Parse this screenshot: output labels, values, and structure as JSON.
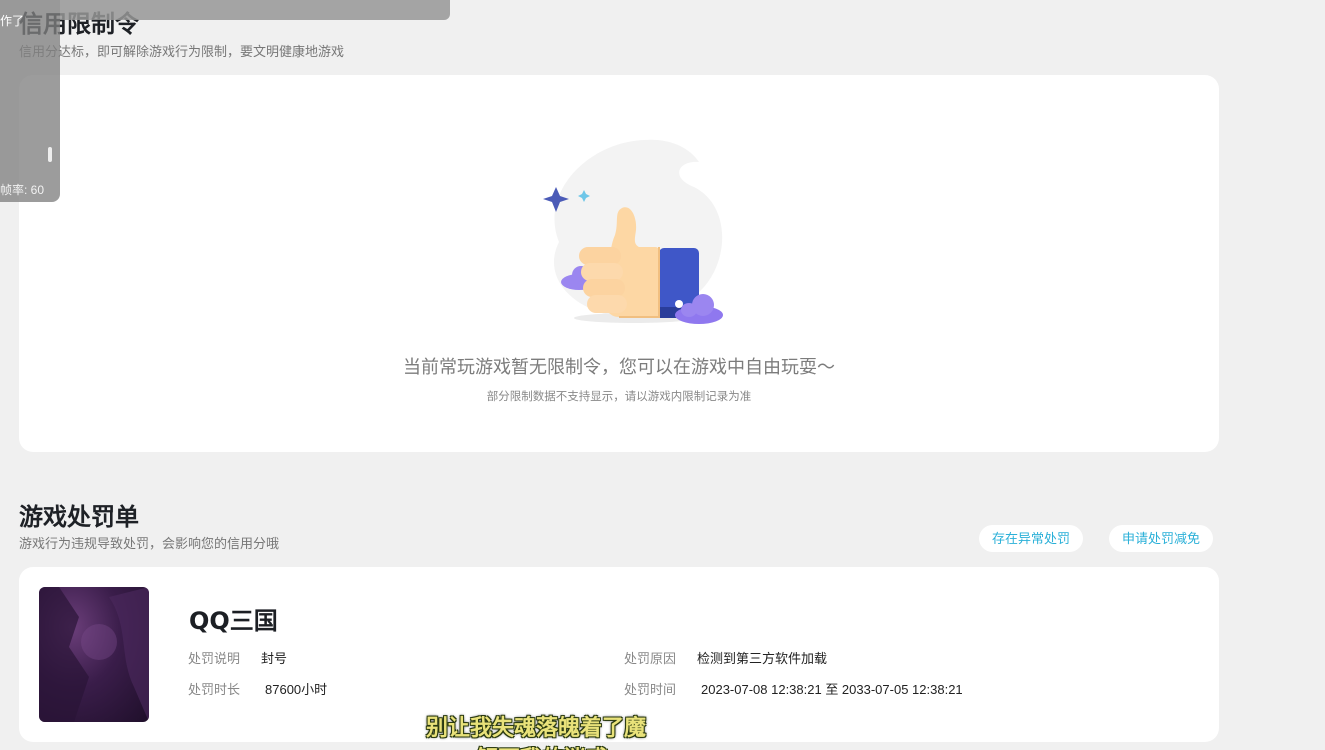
{
  "credit_section": {
    "title": "信用限制令",
    "subtitle": "信用分达标，即可解除游戏行为限制，要文明健康地游戏",
    "empty_main": "当前常玩游戏暂无限制令，您可以在游戏中自由玩耍～",
    "empty_sub": "部分限制数据不支持显示，请以游戏内限制记录为准",
    "illustration_icon": "thumbs-up-icon"
  },
  "penalty_section": {
    "title": "游戏处罚单",
    "subtitle": "游戏行为违规导致处罚，会影响您的信用分哦",
    "abnormal_button": "存在异常处罚",
    "appeal_button": "申请处罚减免"
  },
  "penalty_card": {
    "game_name": "QQ三国",
    "desc_label": "处罚说明",
    "desc_value": "封号",
    "duration_label": "处罚时长",
    "duration_value": "87600小时",
    "reason_label": "处罚原因",
    "reason_value": "检测到第三方软件加载",
    "time_label": "处罚时间",
    "time_value": "2023-07-08 12:38:21 至 2033-07-05 12:38:21"
  },
  "overlay": {
    "top_text": "作了",
    "fps_text": "帧率: 60"
  },
  "video_subtitle": {
    "line1": "别让我失魂落魄着了魔",
    "line2": "解不我的迷惑"
  },
  "colors": {
    "accent": "#2ab0d8",
    "background": "#f0f0f0",
    "card": "#ffffff"
  }
}
